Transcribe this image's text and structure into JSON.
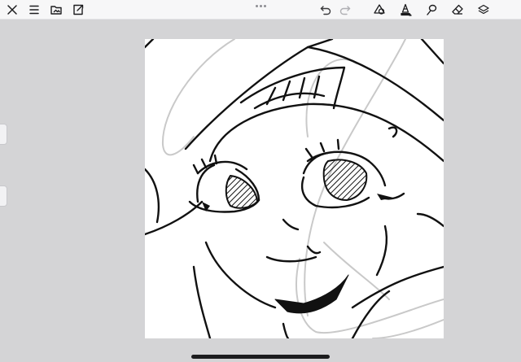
{
  "toolbar": {
    "left": [
      {
        "name": "close-icon"
      },
      {
        "name": "menu-icon"
      },
      {
        "name": "gallery-folder-icon"
      },
      {
        "name": "export-icon"
      }
    ],
    "center": {
      "name": "more-options-dots-icon"
    },
    "right": [
      {
        "name": "undo-icon"
      },
      {
        "name": "redo-icon"
      },
      {
        "name": "shape-tool-icon"
      },
      {
        "name": "pencil-brush-icon"
      },
      {
        "name": "lasso-selection-icon"
      },
      {
        "name": "eraser-icon"
      },
      {
        "name": "layers-icon"
      }
    ]
  },
  "canvas": {
    "background": "#ffffff",
    "artwork": "line-art-character-face-sketch"
  },
  "colors": {
    "workspace": "#d4d4d6",
    "toolbar": "#f7f7f8",
    "ink": "#111111",
    "sketch": "#c9c9c9"
  }
}
